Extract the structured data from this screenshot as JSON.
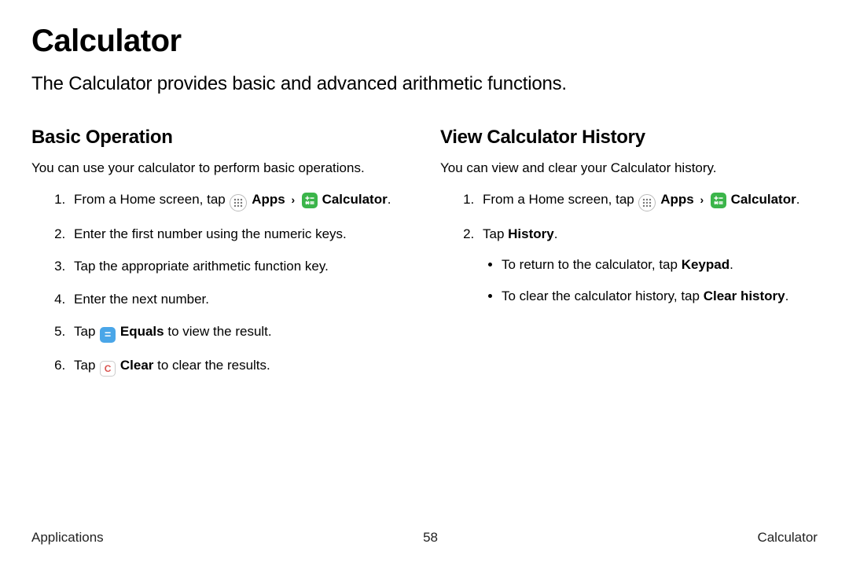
{
  "title": "Calculator",
  "intro": "The Calculator provides basic and advanced arithmetic functions.",
  "left": {
    "heading": "Basic Operation",
    "desc": "You can use your calculator to perform basic operations.",
    "step1_a": "From a Home screen, tap ",
    "apps_label": "Apps",
    "calc_label": "Calculator",
    "step1_end": ".",
    "step2": "Enter the first number using the numeric keys.",
    "step3": "Tap the appropriate arithmetic function key.",
    "step4": "Enter the next number.",
    "step5_a": "Tap ",
    "equals_label": "Equals",
    "step5_b": " to view the result.",
    "step6_a": "Tap ",
    "clear_label": "Clear",
    "step6_b": " to clear the results."
  },
  "right": {
    "heading": "View Calculator History",
    "desc": "You can view and clear your Calculator history.",
    "step1_a": "From a Home screen, tap ",
    "apps_label": "Apps",
    "calc_label": "Calculator",
    "step1_end": ".",
    "step2_a": "Tap ",
    "history_label": "History",
    "step2_b": ".",
    "bullet1_a": "To return to the calculator, tap ",
    "keypad_label": "Keypad",
    "bullet1_b": ".",
    "bullet2_a": "To clear the calculator history, tap ",
    "clearhist_label": "Clear history",
    "bullet2_b": "."
  },
  "footer": {
    "left": "Applications",
    "center": "58",
    "right": "Calculator"
  },
  "glyphs": {
    "equals": "=",
    "clear": "C",
    "chevron": "›"
  }
}
